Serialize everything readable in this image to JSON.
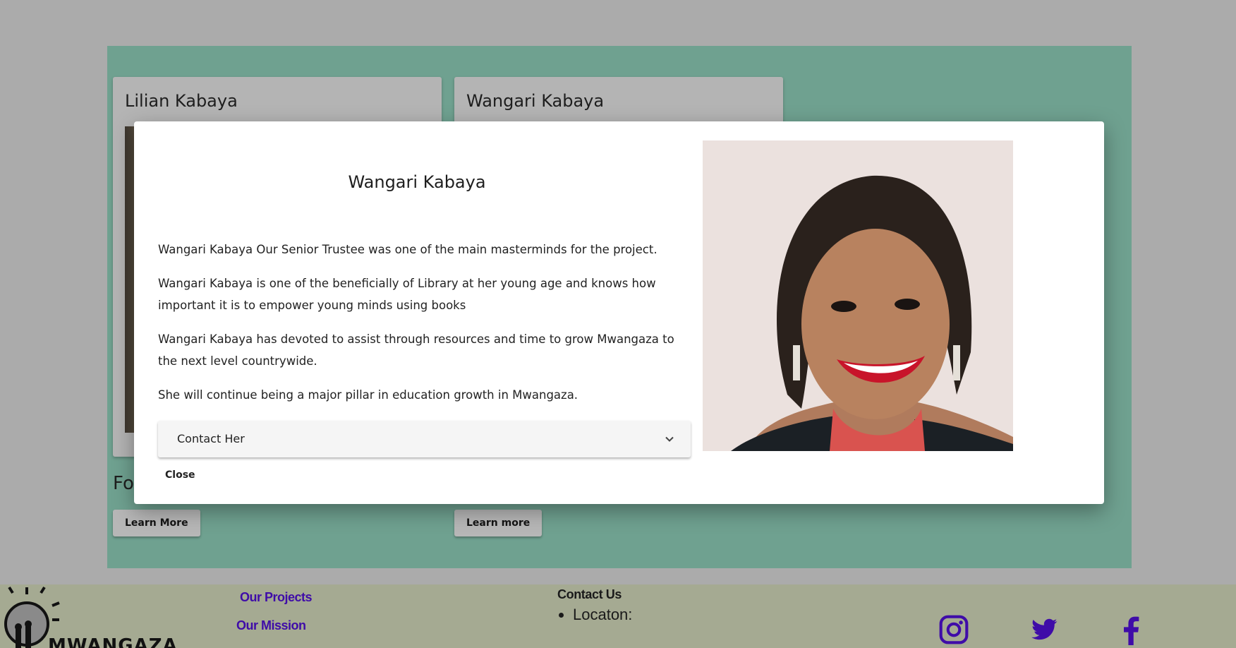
{
  "cards": [
    {
      "name": "Lilian Kabaya",
      "footer_text": "Fo",
      "button_label": "Learn More"
    },
    {
      "name": "Wangari Kabaya",
      "button_label": "Learn more"
    }
  ],
  "modal": {
    "title": "Wangari Kabaya",
    "paragraphs": [
      "Wangari Kabaya Our Senior Trustee was one of the main masterminds for the project.",
      "Wangari Kabaya is one of the beneficially of Library at her young age and knows how important it is to empower young minds using books",
      "Wangari Kabaya has devoted to assist through resources and time to grow Mwangaza to the next level countrywide.",
      "She will continue being a major pillar in education growth in Mwangaza."
    ],
    "accordion_label": "Contact Her",
    "close_label": "Close"
  },
  "footer": {
    "logo_text": "MWANGAZA",
    "links": [
      "Our Projects",
      "Our Mission"
    ],
    "contact_title": "Contact Us",
    "contact_items": [
      "Locaton:"
    ],
    "social_icons": [
      "instagram-icon",
      "twitter-icon",
      "facebook-icon"
    ],
    "link_color": "#3f0ca8"
  },
  "colors": {
    "section_bg": "#6fa190",
    "footer_bg": "#a5aa92",
    "page_bg": "#ababab"
  }
}
